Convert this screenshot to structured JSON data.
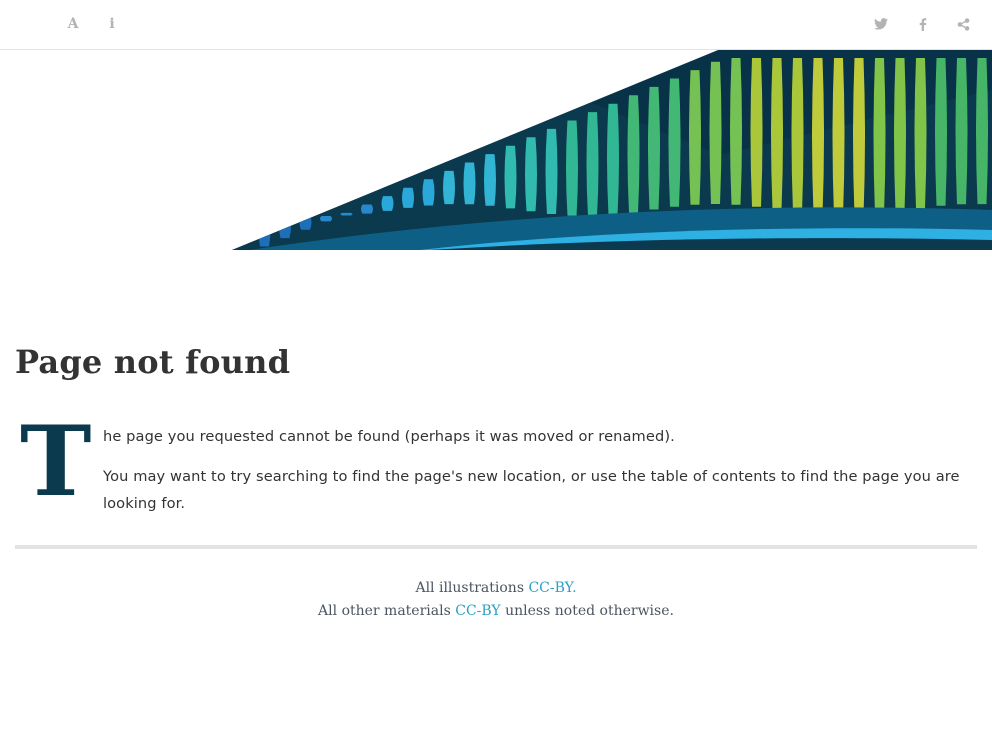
{
  "topbar": {
    "left_icons": [
      "font-settings-icon",
      "info-icon"
    ],
    "right_icons": [
      "twitter-icon",
      "facebook-icon",
      "share-icon"
    ],
    "font_glyph": "A",
    "info_glyph": "i"
  },
  "main": {
    "title": "Page not found",
    "dropcap": "T",
    "paragraph1_rest": "he page you requested cannot be found (perhaps it was moved or renamed).",
    "paragraph2": "You may want to try searching to find the page's new location, or use the table of contents to find the page you are looking for."
  },
  "footer": {
    "line1_prefix": "All illustrations ",
    "line1_link": "CC-BY.",
    "line2_prefix": "All other materials ",
    "line2_link": "CC-BY",
    "line2_suffix": " unless noted otherwise."
  },
  "colors": {
    "title": "#333333",
    "dropcap": "#0b3a4f",
    "link": "#2a9fc5",
    "banner_navy": "#0b3a4f"
  }
}
